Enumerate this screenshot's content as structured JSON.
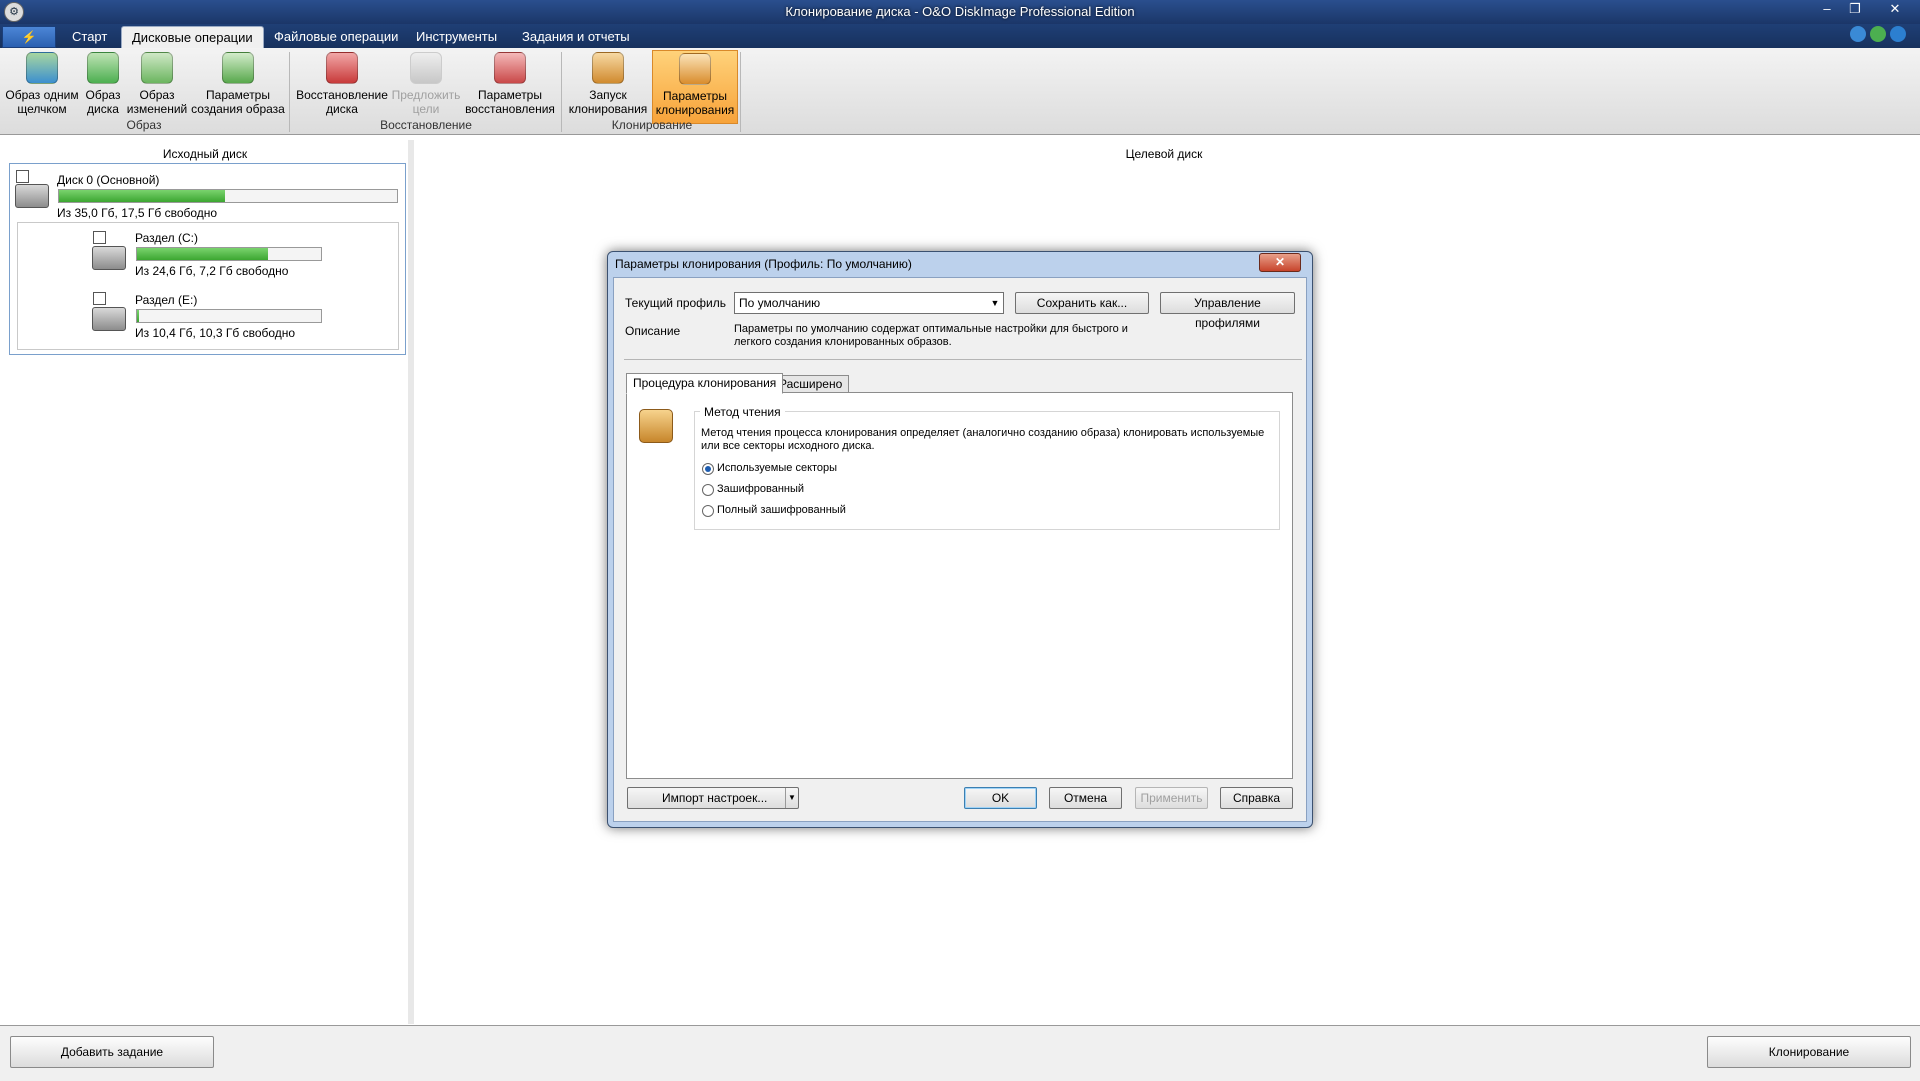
{
  "window": {
    "title": "Клонирование диска - O&O DiskImage Professional Edition"
  },
  "app_menu": {
    "label": "⚡"
  },
  "ribbon": {
    "tabs": [
      {
        "label": "Старт",
        "active": false
      },
      {
        "label": "Дисковые операции",
        "active": true
      },
      {
        "label": "Файловые операции",
        "active": false
      },
      {
        "label": "Инструменты",
        "active": false
      },
      {
        "label": "Задания и отчеты",
        "active": false
      }
    ],
    "buttons": [
      {
        "label": "Образ одним\nщелчком",
        "icon": "disk-image-icon",
        "state": "normal"
      },
      {
        "label": "Образ\nдиска",
        "icon": "disk-image-icon",
        "state": "normal"
      },
      {
        "label": "Образ\nизменений",
        "icon": "incremental-image-icon",
        "state": "normal"
      },
      {
        "label": "Параметры\nсоздания образа",
        "icon": "settings-icon",
        "state": "normal"
      },
      {
        "label": "Восстановление\nдиска",
        "icon": "restore-icon",
        "state": "normal"
      },
      {
        "label": "Предложить\nцели",
        "icon": "suggest-targets-icon",
        "state": "disabled"
      },
      {
        "label": "Параметры\nвосстановления",
        "icon": "restore-settings-icon",
        "state": "normal"
      },
      {
        "label": "Запуск\nклонирования",
        "icon": "clone-start-icon",
        "state": "normal"
      },
      {
        "label": "Параметры\nклонирования",
        "icon": "clone-settings-icon",
        "state": "active"
      }
    ],
    "groups": [
      "Образ",
      "Восстановление",
      "Клонирование"
    ]
  },
  "source": {
    "heading": "Исходный диск",
    "disk": {
      "name": "Диск 0 (Основной)",
      "info": "Из 35,0 Гб, 17,5 Гб свободно",
      "used_fraction": 0.49
    },
    "partitions": [
      {
        "name": "Раздел (C:)",
        "info": "Из 24,6 Гб, 7,2 Гб свободно",
        "used_fraction": 0.71
      },
      {
        "name": "Раздел (E:)",
        "info": "Из 10,4 Гб, 10,3 Гб свободно",
        "used_fraction": 0.01
      }
    ]
  },
  "target": {
    "heading": "Целевой диск"
  },
  "bottom": {
    "add_task": "Добавить задание",
    "clone": "Клонирование"
  },
  "dialog": {
    "title": "Параметры клонирования (Профиль: По умолчанию)",
    "profile_label": "Текущий профиль",
    "profile_value": "По умолчанию",
    "save_as": "Сохранить как...",
    "manage_profiles": "Управление профилями",
    "description_label": "Описание",
    "description": "Параметры по умолчанию содержат оптимальные настройки для быстрого и\nлегкого создания клонированных образов.",
    "tabs": [
      {
        "label": "Процедура клонирования",
        "active": true
      },
      {
        "label": "Расширено",
        "active": false
      }
    ],
    "read_method": {
      "legend": "Метод чтения",
      "text": "Метод чтения процесса клонирования определяет (аналогично созданию образа) клонировать используемые\nили все секторы исходного диска.",
      "options": [
        {
          "label": "Используемые секторы",
          "checked": true
        },
        {
          "label": "Зашифрованный",
          "checked": false
        },
        {
          "label": "Полный зашифрованный",
          "checked": false
        }
      ]
    },
    "import_settings": "Импорт настроек...",
    "ok": "OK",
    "cancel": "Отмена",
    "apply": "Применить",
    "help": "Справка"
  },
  "colors": {
    "accent": "#f7a33a",
    "bar_fill": "#3ca631",
    "title_bar": "#1b3668"
  }
}
